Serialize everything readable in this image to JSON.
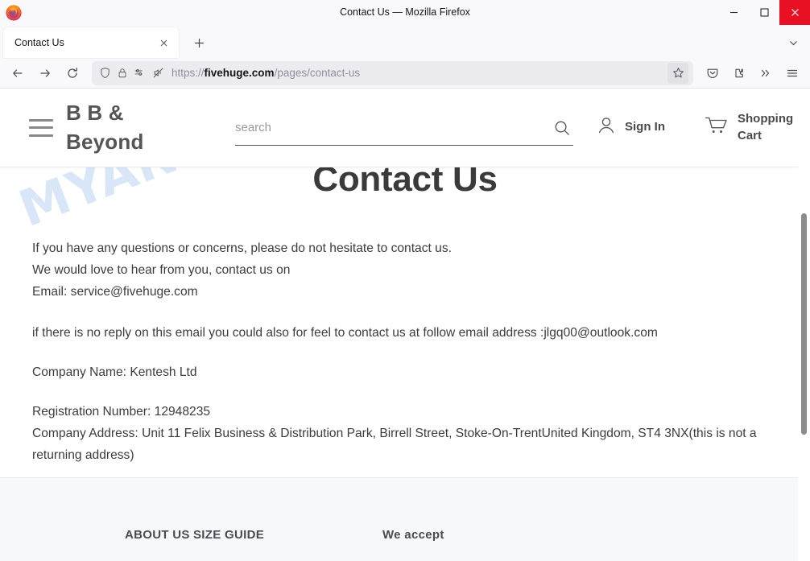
{
  "browser": {
    "window_title": "Contact Us — Mozilla Firefox",
    "app_icon": "firefox-logo-icon",
    "window_controls": {
      "minimize": "minimize-icon",
      "maximize": "maximize-icon",
      "close": "close-icon",
      "close_color": "#e81123"
    },
    "tabs": [
      {
        "title": "Contact Us",
        "close_label": "close-tab-icon",
        "active": true
      }
    ],
    "new_tab_label": "new-tab-icon",
    "tab_list_chevron": "chevron-down-icon",
    "toolbar": {
      "back": "back-arrow-icon",
      "forward": "forward-arrow-icon",
      "reload": "reload-icon",
      "shield": "tracking-protection-shield-icon",
      "lock": "padlock-icon",
      "permissions": "permissions-icon",
      "autoplay_blocked": "autoplay-blocked-icon",
      "bookmark_star": "bookmark-star-icon",
      "pocket": "pocket-icon",
      "extensions": "extensions-icon",
      "overflow": "overflow-chevrons-icon",
      "app_menu": "hamburger-menu-icon"
    },
    "url": {
      "scheme": "https://",
      "domain": "fivehuge.com",
      "path": "/pages/contact-us"
    }
  },
  "site": {
    "header": {
      "menu_icon": "hamburger-menu-icon",
      "brand": "B B & Beyond",
      "search": {
        "placeholder": "search",
        "value": "",
        "icon": "search-icon"
      },
      "account": {
        "icon": "user-icon",
        "label": "Sign In"
      },
      "cart": {
        "icon": "shopping-cart-icon",
        "label": "Shopping Cart"
      }
    },
    "page": {
      "title": "Contact Us",
      "paragraphs": {
        "line1": "If you have any questions or concerns, please do not hesitate to contact us.",
        "line2": "We would love to hear from you, contact us on",
        "line3": "Email: service@fivehuge.com",
        "line4": "if there is no reply on this email you could also for feel to contact us at follow email address :jlgq00@outlook.com",
        "line5": " Company Name: Kentesh Ltd",
        "line6": "Registration Number: 12948235",
        "line7": "Company Address: Unit 11 Felix Business & Distribution Park, Birrell Street, Stoke-On-TrentUnited Kingdom, ST4 3NX(this is not a returning address)"
      }
    },
    "footer": {
      "columns": [
        {
          "heading": "ABOUT US"
        },
        {
          "heading": "SIZE GUIDE"
        },
        {
          "heading": "We accept"
        }
      ]
    }
  },
  "overlay": {
    "watermark": "MYANTISPYWARE.COM",
    "watermark_color": "#c3d7f5"
  }
}
